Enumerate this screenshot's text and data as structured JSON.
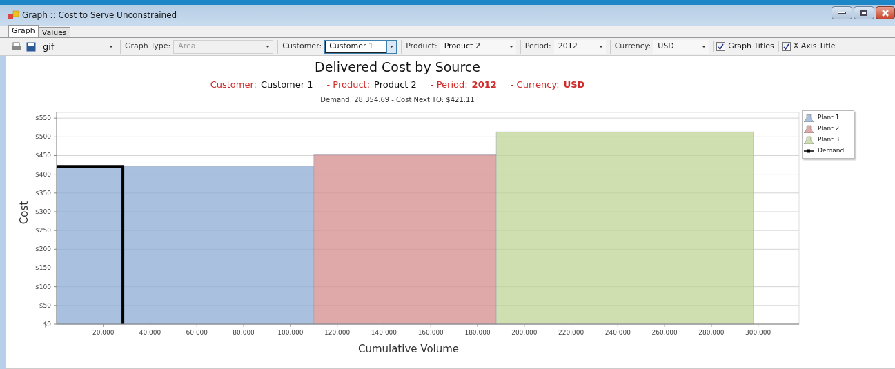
{
  "window": {
    "title": "Graph :: Cost to Serve Unconstrained"
  },
  "tabs": [
    {
      "label": "Graph",
      "selected": true
    },
    {
      "label": "Values",
      "selected": false
    }
  ],
  "toolbar": {
    "format": {
      "value": "gif"
    },
    "combos": [
      {
        "label": "Graph Type:",
        "value": "Area",
        "disabled": true,
        "focused": false
      },
      {
        "label": "Customer:",
        "value": "Customer 1",
        "disabled": false,
        "focused": true
      },
      {
        "label": "Product:",
        "value": "Product 2",
        "disabled": false,
        "focused": false
      },
      {
        "label": "Period:",
        "value": "2012",
        "disabled": false,
        "focused": false
      },
      {
        "label": "Currency:",
        "value": "USD",
        "disabled": false,
        "focused": false
      }
    ],
    "checkboxes": [
      {
        "label": "Graph Titles",
        "checked": true
      },
      {
        "label": "X Axis Title",
        "checked": true
      }
    ]
  },
  "chart": {
    "title": "Delivered Cost by Source",
    "subtitle": [
      {
        "text": "Customer:",
        "kind": "label"
      },
      {
        "text": "Customer 1",
        "kind": "value"
      },
      {
        "text": "- Product:",
        "kind": "label"
      },
      {
        "text": "Product 2",
        "kind": "value"
      },
      {
        "text": "- Period:",
        "kind": "label"
      },
      {
        "text": "2012",
        "kind": "strong"
      },
      {
        "text": "- Currency:",
        "kind": "label"
      },
      {
        "text": "USD",
        "kind": "strong"
      }
    ],
    "note": "Demand: 28,354.69 - Cost Next TO: $421.11",
    "chart_data": {
      "type": "area",
      "xlabel": "Cumulative Volume",
      "ylabel": "Cost",
      "x": [
        0,
        28354.69,
        28354.69,
        110000,
        188000,
        298000
      ],
      "grid": true,
      "series": [
        {
          "name": "Plant 1",
          "color": "#a9c0de",
          "values": [
            421,
            421,
            421,
            421,
            null,
            null
          ]
        },
        {
          "name": "Plant 2",
          "color": "#dfa9aa",
          "values": [
            null,
            null,
            null,
            452,
            452,
            null
          ]
        },
        {
          "name": "Plant 3",
          "color": "#d0dfb0",
          "values": [
            null,
            null,
            null,
            null,
            513,
            513
          ]
        },
        {
          "name": "Demand",
          "color": "#000000",
          "type": "line",
          "values": [
            421,
            421,
            0,
            null,
            null,
            null
          ]
        }
      ],
      "xlim": [
        0,
        317500
      ],
      "ylim": [
        0,
        565
      ],
      "xticks": [
        {
          "value": 20000,
          "label": "20,000"
        },
        {
          "value": 40000,
          "label": "40,000"
        },
        {
          "value": 60000,
          "label": "60,000"
        },
        {
          "value": 80000,
          "label": "80,000"
        },
        {
          "value": 100000,
          "label": "100,000"
        },
        {
          "value": 120000,
          "label": "120,000"
        },
        {
          "value": 140000,
          "label": "140,000"
        },
        {
          "value": 160000,
          "label": "160,000"
        },
        {
          "value": 180000,
          "label": "180,000"
        },
        {
          "value": 200000,
          "label": "200,000"
        },
        {
          "value": 220000,
          "label": "220,000"
        },
        {
          "value": 240000,
          "label": "240,000"
        },
        {
          "value": 260000,
          "label": "260,000"
        },
        {
          "value": 280000,
          "label": "280,000"
        },
        {
          "value": 300000,
          "label": "300,000"
        }
      ],
      "yticks": [
        {
          "value": 0,
          "label": "$0"
        },
        {
          "value": 50,
          "label": "$50"
        },
        {
          "value": 100,
          "label": "$100"
        },
        {
          "value": 150,
          "label": "$150"
        },
        {
          "value": 200,
          "label": "$200"
        },
        {
          "value": 250,
          "label": "$250"
        },
        {
          "value": 300,
          "label": "$300"
        },
        {
          "value": 350,
          "label": "$350"
        },
        {
          "value": 400,
          "label": "$400"
        },
        {
          "value": 450,
          "label": "$450"
        },
        {
          "value": 500,
          "label": "$500"
        },
        {
          "value": 550,
          "label": "$550"
        }
      ]
    }
  }
}
